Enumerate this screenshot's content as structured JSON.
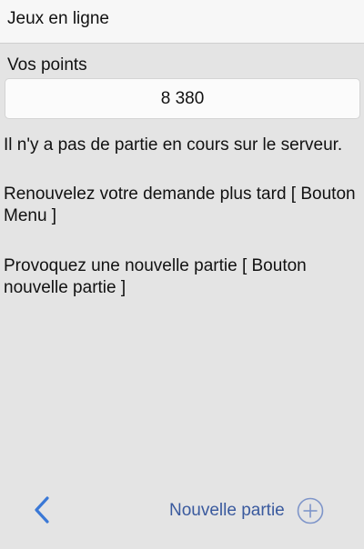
{
  "header": {
    "title": "Jeux en ligne"
  },
  "points": {
    "label": "Vos points",
    "value": "8 380"
  },
  "messages": {
    "no_game": "Il n'y a pas de partie en cours sur le serveur.",
    "retry": "Renouvelez votre demande plus tard  [ Bouton Menu ]",
    "new_game": "Provoquez une nouvelle partie [ Bouton nouvelle partie ]"
  },
  "toolbar": {
    "back_icon": "chevron-left-icon",
    "new_game_label": "Nouvelle partie",
    "new_game_icon": "plus-circle-icon"
  },
  "colors": {
    "accent": "#3a78d6",
    "link_text": "#3a5a9e",
    "background": "#e4e4e4"
  }
}
